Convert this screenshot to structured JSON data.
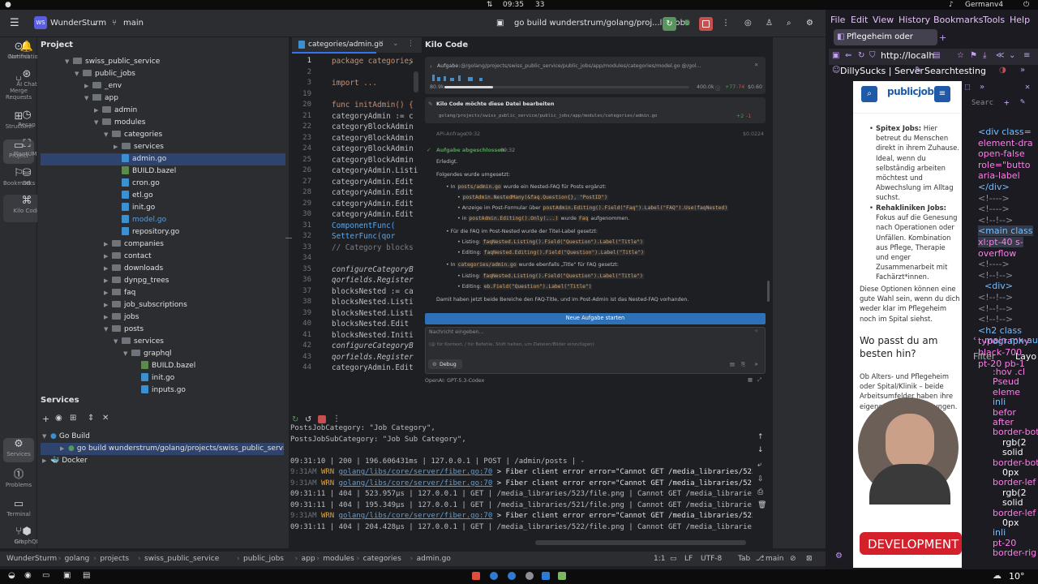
{
  "system_bar": {
    "time": "09:35",
    "count": "33",
    "keyboard": "German",
    "keyboard_variant": "v4"
  },
  "ide": {
    "project_name": "WunderSturm",
    "project_badge": "WS",
    "branch": "main",
    "run_config": "go build wunderstrum/golang/proj...lic_jobs",
    "project_panel_title": "Project",
    "left_tools": [
      "Commit",
      "Merge Requests",
      "Structure",
      "Project",
      "Bookmarks"
    ],
    "left_tools_bottom": [
      "Services",
      "Problems",
      "Terminal",
      "Git"
    ],
    "right_tools": [
      "Notifications",
      "AI Chat",
      "Recap",
      "PlantUML",
      "DB",
      "Kilo Code",
      "GraphQL"
    ],
    "tree": [
      {
        "label": "swiss_public_service",
        "type": "folder",
        "depth": 0,
        "open": true
      },
      {
        "label": "public_jobs",
        "type": "folder",
        "depth": 1,
        "open": true
      },
      {
        "label": "_env",
        "type": "folder",
        "depth": 2,
        "open": false
      },
      {
        "label": "app",
        "type": "folder",
        "depth": 2,
        "open": true
      },
      {
        "label": "admin",
        "type": "folder",
        "depth": 3,
        "open": false
      },
      {
        "label": "modules",
        "type": "folder",
        "depth": 3,
        "open": true
      },
      {
        "label": "categories",
        "type": "folder",
        "depth": 4,
        "open": true
      },
      {
        "label": "services",
        "type": "folder",
        "depth": 5,
        "open": false
      },
      {
        "label": "admin.go",
        "type": "go",
        "depth": 5,
        "selected": true
      },
      {
        "label": "BUILD.bazel",
        "type": "bazel",
        "depth": 5
      },
      {
        "label": "cron.go",
        "type": "go",
        "depth": 5
      },
      {
        "label": "etl.go",
        "type": "go",
        "depth": 5
      },
      {
        "label": "init.go",
        "type": "go",
        "depth": 5
      },
      {
        "label": "model.go",
        "type": "go",
        "depth": 5,
        "highlight": true
      },
      {
        "label": "repository.go",
        "type": "go",
        "depth": 5
      },
      {
        "label": "companies",
        "type": "folder",
        "depth": 4,
        "open": false
      },
      {
        "label": "contact",
        "type": "folder",
        "depth": 4,
        "open": false
      },
      {
        "label": "downloads",
        "type": "folder",
        "depth": 4,
        "open": false
      },
      {
        "label": "dynpg_trees",
        "type": "folder",
        "depth": 4,
        "open": false
      },
      {
        "label": "faq",
        "type": "folder",
        "depth": 4,
        "open": false
      },
      {
        "label": "job_subscriptions",
        "type": "folder",
        "depth": 4,
        "open": false
      },
      {
        "label": "jobs",
        "type": "folder",
        "depth": 4,
        "open": false
      },
      {
        "label": "posts",
        "type": "folder",
        "depth": 4,
        "open": true
      },
      {
        "label": "services",
        "type": "folder",
        "depth": 5,
        "open": true
      },
      {
        "label": "graphql",
        "type": "folder",
        "depth": 6,
        "open": true
      },
      {
        "label": "BUILD.bazel",
        "type": "bazel",
        "depth": 7
      },
      {
        "label": "init.go",
        "type": "go",
        "depth": 7
      },
      {
        "label": "inputs.go",
        "type": "go",
        "depth": 7
      }
    ],
    "editor_tab": "categories/admin.go",
    "code_lines": [
      {
        "n": "1",
        "text": "package categories"
      },
      {
        "n": "2",
        "text": ""
      },
      {
        "n": "3",
        "text": "import ..."
      },
      {
        "n": "19",
        "text": ""
      },
      {
        "n": "20",
        "text": "func initAdmin() {"
      },
      {
        "n": "21",
        "text": "    categoryAdmin := c"
      },
      {
        "n": "22",
        "text": "    categoryBlockAdmin"
      },
      {
        "n": "23",
        "text": "    categoryBlockAdmin"
      },
      {
        "n": "24",
        "text": "    categoryBlockAdmin"
      },
      {
        "n": "25",
        "text": "    categoryBlockAdmin"
      },
      {
        "n": "26",
        "text": "    categoryAdmin.Listi"
      },
      {
        "n": "27",
        "text": "    categoryAdmin.Edit"
      },
      {
        "n": "28",
        "text": "    categoryAdmin.Edit"
      },
      {
        "n": "29",
        "text": "    categoryAdmin.Edit"
      },
      {
        "n": "30",
        "text": "    categoryAdmin.Edit"
      },
      {
        "n": "31",
        "text": "        ComponentFunc("
      },
      {
        "n": "32",
        "text": "        SetterFunc(qor"
      },
      {
        "n": "33",
        "text": "    // Category blocks"
      },
      {
        "n": "34",
        "text": ""
      },
      {
        "n": "35",
        "text": "    configureCategoryB"
      },
      {
        "n": "36",
        "text": "    qorfields.Register"
      },
      {
        "n": "37",
        "text": "    blocksNested := ca"
      },
      {
        "n": "38",
        "text": "    blocksNested.Listi"
      },
      {
        "n": "39",
        "text": "    blocksNested.Listi"
      },
      {
        "n": "40",
        "text": "    blocksNested.Edit"
      },
      {
        "n": "41",
        "text": "    blocksNested.Initi"
      },
      {
        "n": "42",
        "text": "    configureCategoryB"
      },
      {
        "n": "43",
        "text": "    qorfields.Register"
      },
      {
        "n": "44",
        "text": "    categoryAdmin.Edit"
      }
    ],
    "kilo": {
      "title": "Kilo Code",
      "task_label": "Aufgabe:",
      "task_path": "@/golang/projects/swiss_public_service/public_jobs/app/modules/categories/model.go @/gol...",
      "tokens_left": "80.9k",
      "tokens_right": "400.0k",
      "diff_plus": "+77",
      "diff_minus": "-74",
      "cost": "$0.60",
      "edit_title": "Kilo Code möchte diese Datei bearbeiten",
      "edit_path": "golang/projects/swiss_public_service/public_jobs/app/modules/categories/admin.go",
      "edit_plus": "+2",
      "edit_minus": "-1",
      "api_label": "API-Anfrage",
      "api_time": "09:32",
      "api_cost": "$0.0224",
      "done_title": "Aufgabe abgeschlossen",
      "done_time": "09:32",
      "done_text": "Erledigt.",
      "changes_intro": "Folgendes wurde umgesetzt:",
      "bullet1_pre": "In",
      "bullet1_code": "posts/admin.go",
      "bullet1_post": "wurde ein Nested-FAQ für Posts ergänzt:",
      "sub1_code": "postAdmin.NestedMany(&faq.Question{}, \"PostID\")",
      "sub2_pre": "Anzeige im Post-Formular über",
      "sub2_code": "postAdmin.Editing().Field(\"Faq\").Label(\"FAQ\").Use(faqNested)",
      "sub3_pre": "in",
      "sub3_code": "postAdmin.Editing().Only(...)",
      "sub3_mid": "wurde",
      "sub3_code2": "Faq",
      "sub3_post": "aufgenommen.",
      "bullet2": "Für die FAQ im Post-Nested wurde der Titel-Label gesetzt:",
      "sub4_pre": "Listing:",
      "sub4_code": "faqNested.Listing().Field(\"Question\").Label(\"Title\")",
      "sub5_pre": "Editing:",
      "sub5_code": "faqNested.Editing().Field(\"Question\").Label(\"Title\")",
      "bullet3_pre": "In",
      "bullet3_code": "categories/admin.go",
      "bullet3_post": "wurde ebenfalls „Title\" für FAQ gesetzt:",
      "sub6_pre": "Listing:",
      "sub6_code": "faqNested.Listing().Field(\"Question\").Label(\"Title\")",
      "sub7_pre": "Editing:",
      "sub7_code": "eb.Field(\"Question\").Label(\"Title\")",
      "summary": "Damit haben jetzt beide Bereiche den FAQ-Title, und im Post-Admin ist das Nested-FAQ vorhanden.",
      "new_task_button": "Neue Aufgabe starten",
      "input_placeholder": "Nachricht eingeben...",
      "input_hint": "(@ für Kontext, / für Befehle, Shift halten, um Dateien/Bilder einzufügen)",
      "mode": "Debug",
      "model": "OpenAI: GPT-5.3-Codex"
    },
    "services_title": "Services",
    "services": [
      {
        "label": "Go Build",
        "depth": 0
      },
      {
        "label": "go build wunderstrum/golang/projects/swiss_public_service/p",
        "depth": 1,
        "selected": true
      },
      {
        "label": "Docker",
        "depth": 0
      }
    ],
    "log_lines": [
      {
        "text": "PostsJobCategory: \"Job Category\",",
        "kind": "plain"
      },
      {
        "text": "PostsJobSubCategory: \"Job Sub Category\",",
        "kind": "plain"
      },
      {
        "text": "",
        "kind": "plain"
      },
      {
        "text": "09:31:10 | 200 |  196.606431ms | 127.0.0.1 | POST | /admin/posts | -",
        "kind": "plain"
      },
      {
        "prefix": "9:31AM",
        "level": "WRN",
        "link": "golang/libs/core/server/fiber.go:70",
        "rest": " > Fiber client error error=\"Cannot GET /media_libraries/523/file.pn",
        "kind": "warn"
      },
      {
        "prefix": "9:31AM",
        "level": "WRN",
        "link": "golang/libs/core/server/fiber.go:70",
        "rest": " > Fiber client error error=\"Cannot GET /media_libraries/521/file.pn",
        "kind": "warn"
      },
      {
        "text": "09:31:11 | 404 |     523.957µs | 127.0.0.1 | GET | /media_libraries/523/file.png | Cannot GET /media_libraries/523",
        "kind": "plain"
      },
      {
        "text": "09:31:11 | 404 |     195.349µs | 127.0.0.1 | GET | /media_libraries/521/file.png | Cannot GET /media_libraries/521",
        "kind": "plain"
      },
      {
        "prefix": "9:31AM",
        "level": "WRN",
        "link": "golang/libs/core/server/fiber.go:70",
        "rest": " > Fiber client error error=\"Cannot GET /media_libraries/522/file.pn",
        "kind": "warn"
      },
      {
        "text": "09:31:11 | 404 |     204.428µs | 127.0.0.1 | GET | /media_libraries/522/file.png | Cannot GET /media_libraries/522",
        "kind": "plain"
      }
    ],
    "breadcrumb": [
      "WunderSturm",
      "golang",
      "projects",
      "swiss_public_service",
      "public_jobs",
      "app",
      "modules",
      "categories",
      "admin.go"
    ],
    "status_right": {
      "pos": "1:1",
      "eol": "LF",
      "enc": "UTF-8",
      "indent": "Tab",
      "branch": "main"
    }
  },
  "browser": {
    "menu": [
      "File",
      "Edit",
      "View",
      "History",
      "Bookmarks",
      "Tools",
      "Help"
    ],
    "tab_title": "Pflegeheim oder",
    "url": "http://localh",
    "bookmarks": [
      "DillySucks | Server",
      "Searchtesting"
    ],
    "site_logo": "publicjobs",
    "page_texts": {
      "li1_bold": "Spitex Jobs:",
      "li1_rest": " Hier betreut du Menschen direkt in ihrem Zuhause. Ideal, wenn du selbständig arbeiten möchtest und Abwechslung im Alltag suchst.",
      "li2_bold": "Rehakliniken Jobs:",
      "li2_rest": " Fokus auf die Genesung nach Operationen oder Unfällen. Kombination aus Pflege, Therapie und enger Zusammenarbeit mit Fachärzt*innen.",
      "para": "Diese Optionen können eine gute Wahl sein, wenn du dich weder klar im Pflegeheim noch im Spital siehst.",
      "heading": "Wo passt du am besten hin?",
      "para2": "Ob Alters- und Pflegeheim oder Spital/Klinik – beide Arbeitsumfelder haben ihre eigenen Herausforderungen.",
      "overlay": "DEVELOPMENT"
    },
    "devtools": {
      "search": "Searc",
      "lines": [
        "<div class=",
        "element-dra",
        "open-false",
        "role=\"butto",
        "aria-label",
        "</div>",
        "<!---->",
        "<!---->",
        "<!--!-->",
        "<main class",
        "xl:pt-40 s-",
        "overflow",
        "<!---->",
        "<!--!-->",
        "<div>",
        "<!--!-->",
        "<!--!-->",
        "<!--!-->",
        "<h2 class",
        "typography",
        "black-700",
        "pt-20 pb-1"
      ],
      "crumb": "main.mx-auto",
      "filter": "Filter",
      "layout": "Layo",
      "styles": [
        ":hov .cl",
        "Pseud",
        "eleme",
        "inli",
        "befor",
        "after",
        "border-bot",
        "rgb(2",
        "solid",
        "border-bot",
        "0px",
        "border-lef",
        "rgb(2",
        "solid",
        "border-lef",
        "0px",
        "inli",
        "pt-20",
        "border-rig"
      ]
    }
  },
  "taskbar": {
    "temp": "10°"
  }
}
